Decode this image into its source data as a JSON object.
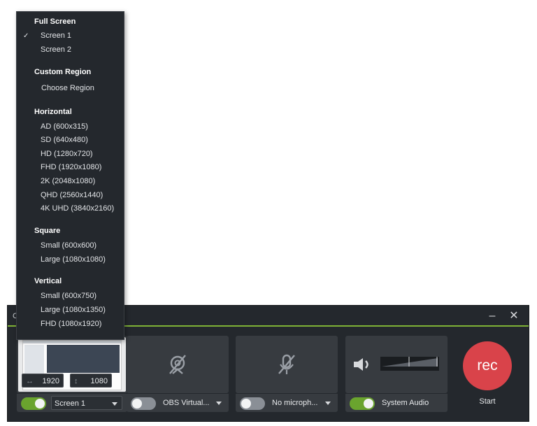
{
  "window": {
    "title_initial": "C",
    "minimize_glyph": "–",
    "close_glyph": "✕"
  },
  "menu": {
    "full_screen_header": "Full Screen",
    "screen1": "Screen 1",
    "screen2": "Screen 2",
    "screen1_checked": true,
    "check_glyph": "✓",
    "custom_region_header": "Custom Region",
    "choose_region": "Choose Region",
    "horizontal_header": "Horizontal",
    "horizontal_items": [
      "AD (600x315)",
      "SD (640x480)",
      "HD (1280x720)",
      "FHD (1920x1080)",
      "2K (2048x1080)",
      "QHD (2560x1440)",
      "4K UHD (3840x2160)"
    ],
    "square_header": "Square",
    "square_items": [
      "Small (600x600)",
      "Large (1080x1080)"
    ],
    "vertical_header": "Vertical",
    "vertical_items": [
      "Small (600x750)",
      "Large (1080x1350)",
      "FHD (1080x1920)"
    ]
  },
  "screen_panel": {
    "width_value": "1920",
    "height_value": "1080",
    "width_icon": "↔",
    "height_icon": "↕",
    "toggle_on": true,
    "selected": "Screen 1"
  },
  "camera_panel": {
    "icon": "camera-off-icon",
    "toggle_on": false,
    "selected": "OBS Virtual..."
  },
  "mic_panel": {
    "icon": "microphone-off-icon",
    "toggle_on": false,
    "selected": "No microph..."
  },
  "audio_panel": {
    "icon": "speaker-icon",
    "toggle_on": true,
    "label": "System Audio"
  },
  "record": {
    "button_label": "rec",
    "start_label": "Start"
  },
  "colors": {
    "accent_green": "#6aa42e",
    "record_red": "#d9434a",
    "panel_bg": "#373b40",
    "dark_bg": "#24282d"
  }
}
